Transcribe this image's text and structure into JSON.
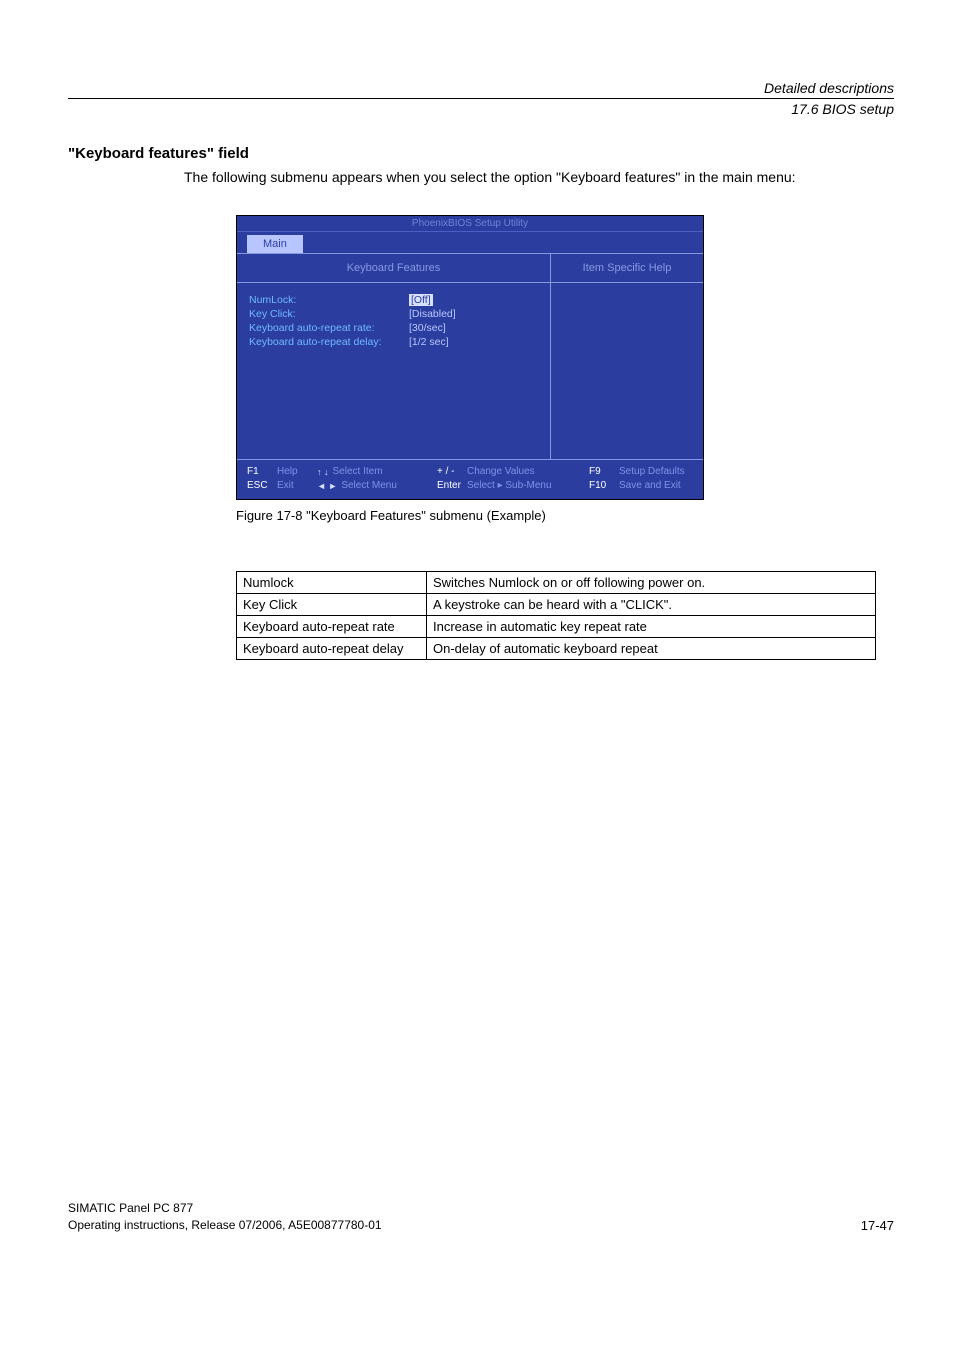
{
  "header": {
    "title": "Detailed descriptions",
    "subtitle": "17.6 BIOS setup"
  },
  "section": {
    "title": "\"Keyboard features\" field",
    "intro": "The following submenu appears when you select the option \"Keyboard features\" in the main menu:"
  },
  "bios": {
    "utility_title": "PhoenixBIOS Setup Utility",
    "tab": "Main",
    "panel_left_title": "Keyboard Features",
    "panel_right_title": "Item Specific Help",
    "items": [
      {
        "label": "NumLock:",
        "value": "[Off]",
        "selected": true
      },
      {
        "label": "Key Click:",
        "value": "[Disabled]",
        "selected": false
      },
      {
        "label": "Keyboard auto-repeat rate:",
        "value": "[30/sec]",
        "selected": false
      },
      {
        "label": "Keyboard auto-repeat delay:",
        "value": "[1/2 sec]",
        "selected": false
      }
    ],
    "footer": {
      "f1": "F1",
      "help": "Help",
      "esc": "ESC",
      "exit": "Exit",
      "updown": "↑ ↓",
      "select_item": "Select Item",
      "leftright": "◄ ►",
      "select_menu": "Select Menu",
      "plusminus": "+ / -",
      "change_values": "Change Values",
      "enter": "Enter",
      "sub_menu": "Select ▸ Sub-Menu",
      "f9": "F9",
      "setup_defaults": "Setup Defaults",
      "f10": "F10",
      "save_exit": "Save and Exit"
    }
  },
  "caption": "Figure 17-8    \"Keyboard Features\" submenu (Example)",
  "table": [
    {
      "k": "Numlock",
      "v": "Switches Numlock on or off following power on."
    },
    {
      "k": "Key Click",
      "v": "A keystroke can be heard with a \"CLICK\"."
    },
    {
      "k": "Keyboard auto-repeat rate",
      "v": "Increase in automatic key repeat rate"
    },
    {
      "k": "Keyboard auto-repeat delay",
      "v": "On-delay of automatic keyboard repeat"
    }
  ],
  "footer": {
    "line1": "SIMATIC Panel PC 877",
    "line2": "Operating instructions, Release 07/2006, A5E00877780-01",
    "page": "17-47"
  }
}
